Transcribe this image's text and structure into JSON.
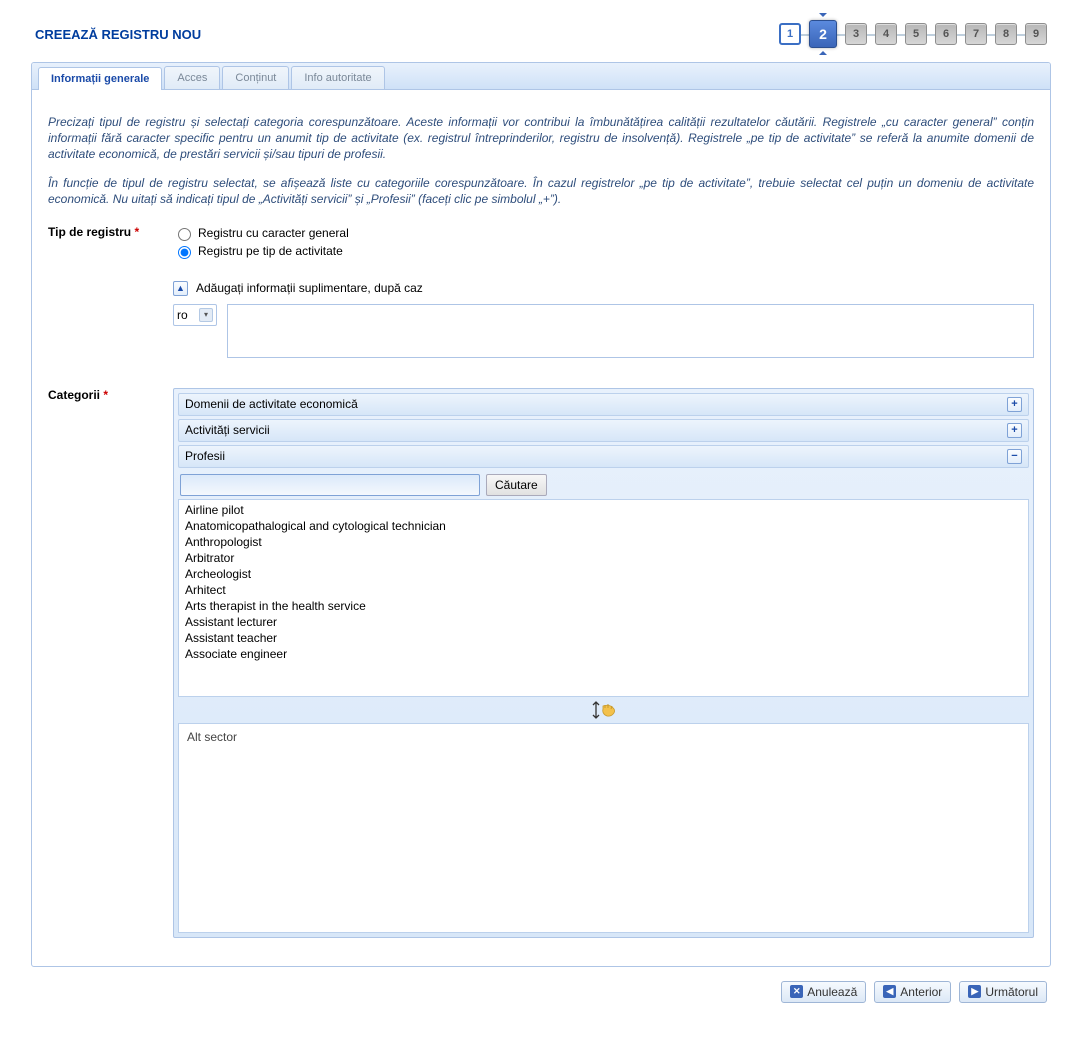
{
  "header": {
    "title": "CREEAZĂ REGISTRU NOU"
  },
  "steps": {
    "total": 9,
    "current": 2
  },
  "tabs": {
    "items": [
      {
        "label": "Informații generale",
        "active": true
      },
      {
        "label": "Acces",
        "active": false
      },
      {
        "label": "Conținut",
        "active": false
      },
      {
        "label": "Info autoritate",
        "active": false
      }
    ]
  },
  "intro": {
    "p1": "Precizați tipul de registru și selectați categoria corespunzătoare. Aceste informații vor contribui la îmbunătățirea calității rezultatelor căutării. Registrele „cu caracter general” conțin informații fără caracter specific pentru un anumit tip de activitate (ex. registrul întreprinderilor, registru de insolvență). Registrele „pe tip de activitate” se referă la anumite domenii de activitate economică, de prestări servicii și/sau tipuri de profesii.",
    "p2": "În funcție de tipul de registru selectat, se afișează liste cu categoriile corespunzătoare. În cazul registrelor „pe tip de activitate”, trebuie selectat cel puțin un domeniu de activitate economică. Nu uitați să indicați tipul de „Activități servicii” și „Profesii” (faceți clic pe simbolul „+”)."
  },
  "registryType": {
    "label": "Tip de registru",
    "options": [
      {
        "label": "Registru cu caracter general",
        "checked": false
      },
      {
        "label": "Registru pe tip de activitate",
        "checked": true
      }
    ],
    "toggleLabel": "Adăugați informații suplimentare, după caz",
    "lang": "ro"
  },
  "categories": {
    "label": "Categorii",
    "sections": {
      "economic": {
        "label": "Domenii de activitate economică",
        "expanded": false
      },
      "servicii": {
        "label": "Activități servicii",
        "expanded": false
      },
      "profesii": {
        "label": "Profesii",
        "expanded": true
      }
    },
    "searchButton": "Căutare",
    "listItems": [
      "Airline pilot",
      "Anatomicopathalogical and cytological technician",
      "Anthropologist",
      "Arbitrator",
      "Archeologist",
      "Arhitect",
      "Arts therapist in the health service",
      "Assistant lecturer",
      "Assistant teacher",
      "Associate engineer"
    ],
    "altSectorLabel": "Alt sector"
  },
  "footer": {
    "cancel": "Anulează",
    "prev": "Anterior",
    "next": "Următorul"
  }
}
